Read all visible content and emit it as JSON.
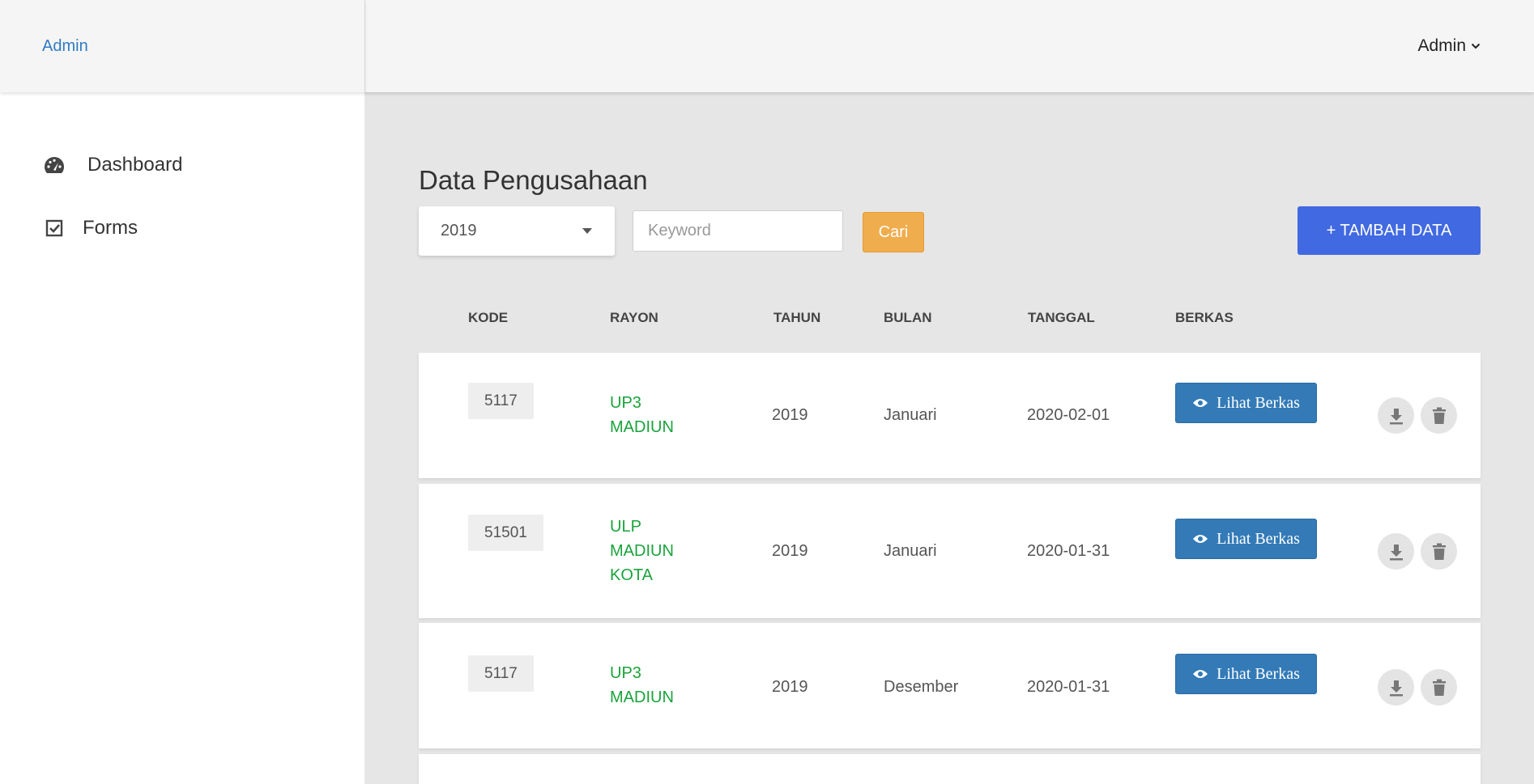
{
  "sidebar": {
    "brand": "Admin",
    "items": [
      {
        "label": "Dashboard",
        "icon": "dashboard-icon"
      },
      {
        "label": "Forms",
        "icon": "checkbox-icon"
      }
    ]
  },
  "header": {
    "user": "Admin"
  },
  "main": {
    "title": "Data Pengusahaan",
    "year_select": "2019",
    "search": {
      "placeholder": "Keyword",
      "value": ""
    },
    "cari_label": "Cari",
    "add_label": "+ TAMBAH DATA",
    "table": {
      "headers": [
        "KODE",
        "RAYON",
        "TAHUN",
        "BULAN",
        "TANGGAL",
        "BERKAS"
      ],
      "lihat_label": "Lihat Berkas",
      "rows": [
        {
          "kode": "5117",
          "rayon": "UP3\nMADIUN",
          "tahun": "2019",
          "bulan": "Januari",
          "tanggal": "2020-02-01"
        },
        {
          "kode": "51501",
          "rayon": "ULP\nMADIUN\nKOTA",
          "tahun": "2019",
          "bulan": "Januari",
          "tanggal": "2020-01-31"
        },
        {
          "kode": "5117",
          "rayon": "UP3\nMADIUN",
          "tahun": "2019",
          "bulan": "Desember",
          "tanggal": "2020-01-31"
        }
      ]
    }
  },
  "colors": {
    "brand_link": "#2f7ac4",
    "rayon_text": "#1aa33c",
    "btn_cari": "#f0ad4e",
    "btn_tambah": "#4169e1",
    "btn_lihat": "#337ab7"
  }
}
